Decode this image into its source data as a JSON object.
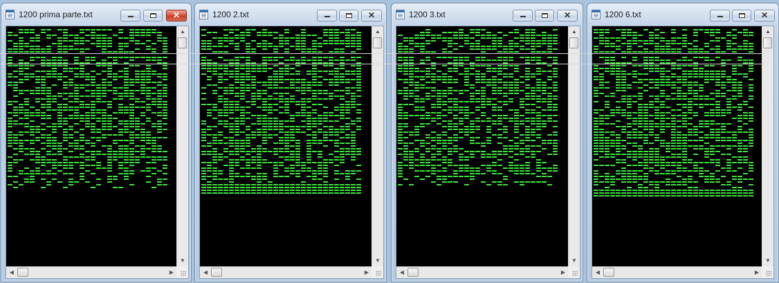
{
  "windows": [
    {
      "title": "1200 prima parte.txt",
      "active": true
    },
    {
      "title": "1200 2.txt",
      "active": false
    },
    {
      "title": "1200 3.txt",
      "active": false
    },
    {
      "title": "1200 6.txt",
      "active": false
    }
  ],
  "icons": {
    "minimize": "minimize-icon",
    "maximize": "maximize-icon",
    "close": "close-icon",
    "scroll_up": "arrow-up-icon",
    "scroll_down": "arrow-down-icon",
    "scroll_left": "arrow-left-icon",
    "scroll_right": "arrow-right-icon"
  },
  "colors": {
    "text_green": "#3ee63e",
    "text_background": "#000000",
    "close_active": "#c8452d"
  }
}
